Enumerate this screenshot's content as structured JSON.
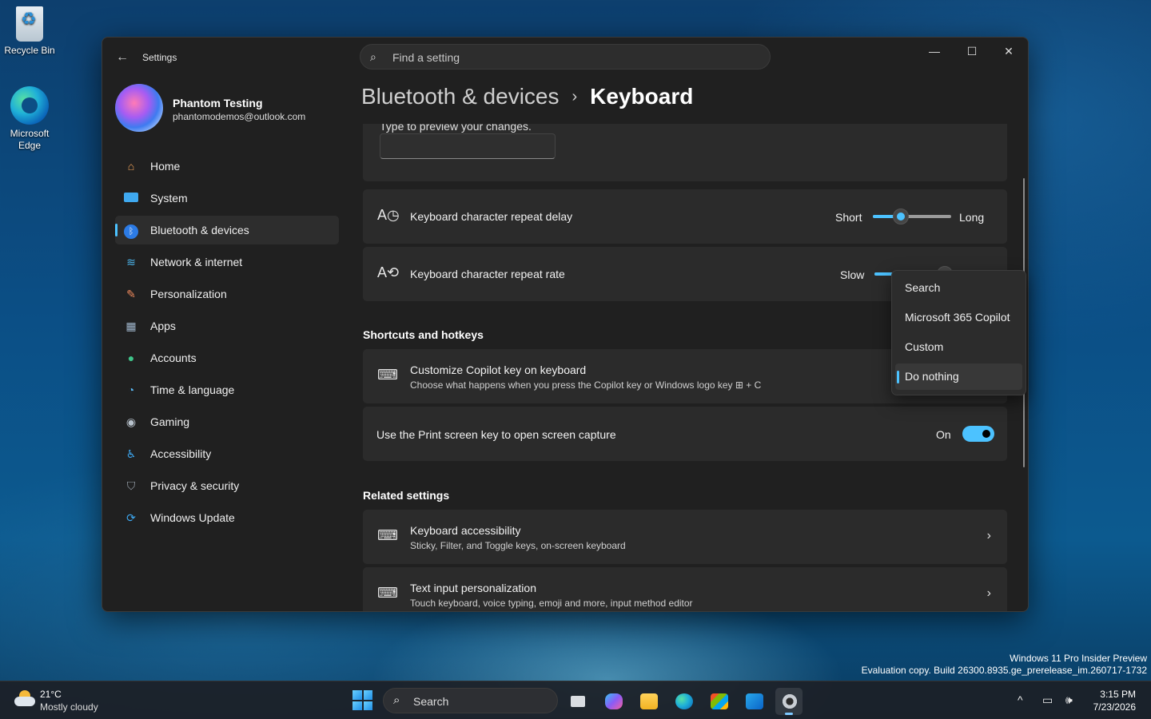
{
  "desktop": {
    "icons": [
      {
        "label": "Recycle Bin"
      },
      {
        "label": "Microsoft Edge"
      }
    ]
  },
  "window": {
    "app_title": "Settings",
    "search_placeholder": "Find a setting",
    "controls": {
      "minimize": "—",
      "maximize": "☐",
      "close": "✕"
    }
  },
  "profile": {
    "name": "Phantom Testing",
    "email": "phantomodemos@outlook.com"
  },
  "sidebar": {
    "items": [
      {
        "label": "Home",
        "icon": "home-icon",
        "active": false
      },
      {
        "label": "System",
        "icon": "system-icon",
        "active": false
      },
      {
        "label": "Bluetooth & devices",
        "icon": "bluetooth-icon",
        "active": true
      },
      {
        "label": "Network & internet",
        "icon": "wifi-icon",
        "active": false
      },
      {
        "label": "Personalization",
        "icon": "brush-icon",
        "active": false
      },
      {
        "label": "Apps",
        "icon": "apps-icon",
        "active": false
      },
      {
        "label": "Accounts",
        "icon": "account-icon",
        "active": false
      },
      {
        "label": "Time & language",
        "icon": "globe-clock-icon",
        "active": false
      },
      {
        "label": "Gaming",
        "icon": "gamepad-icon",
        "active": false
      },
      {
        "label": "Accessibility",
        "icon": "accessibility-icon",
        "active": false
      },
      {
        "label": "Privacy & security",
        "icon": "shield-icon",
        "active": false
      },
      {
        "label": "Windows Update",
        "icon": "update-icon",
        "active": false
      }
    ]
  },
  "breadcrumb": {
    "parent": "Bluetooth & devices",
    "separator": "›",
    "current": "Keyboard"
  },
  "content": {
    "preview": {
      "label": "Type to preview your changes.",
      "value": ""
    },
    "repeat_delay": {
      "title": "Keyboard character repeat delay",
      "min_label": "Short",
      "max_label": "Long",
      "value_fraction": 0.36
    },
    "repeat_rate": {
      "title": "Keyboard character repeat rate",
      "min_label": "Slow",
      "value_fraction": 0.9
    },
    "shortcuts_header": "Shortcuts and hotkeys",
    "copilot_key": {
      "title": "Customize Copilot key on keyboard",
      "subtitle": "Choose what happens when you press the Copilot key or Windows logo key ⊞ + C"
    },
    "print_screen": {
      "title": "Use the Print screen key to open screen capture",
      "state_label": "On",
      "on": true
    },
    "related_header": "Related settings",
    "related": [
      {
        "title": "Keyboard accessibility",
        "subtitle": "Sticky, Filter, and Toggle keys, on-screen keyboard"
      },
      {
        "title": "Text input personalization",
        "subtitle": "Touch keyboard, voice typing, emoji and more, input method editor"
      }
    ]
  },
  "dropdown": {
    "options": [
      "Search",
      "Microsoft 365 Copilot",
      "Custom",
      "Do nothing"
    ],
    "selected": "Do nothing"
  },
  "watermark": {
    "line1": "Windows 11 Pro Insider Preview",
    "line2": "Evaluation copy. Build 26300.8935.ge_prerelease_im.260717-1732"
  },
  "taskbar": {
    "weather": {
      "temp": "21°C",
      "desc": "Mostly cloudy"
    },
    "search_label": "Search",
    "clock": {
      "time": "3:15 PM",
      "date": "7/23/2026"
    },
    "accent": "#4cc2ff"
  }
}
